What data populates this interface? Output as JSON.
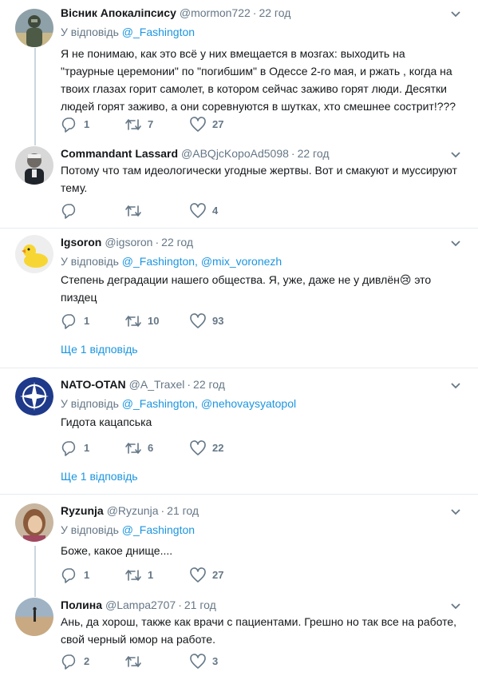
{
  "tweets": [
    {
      "name": "Вісник Апокаліпсису",
      "handle": "@mormon722",
      "time": "22 год",
      "reply_prefix": "У відповідь",
      "reply_to": [
        "@_Fashington"
      ],
      "text": "Я не понимаю, как это всё у них вмещается в мозгах: выходить на \"траурные церемонии\" по \"погибшим\" в Одессе 2-го мая, и ржать , когда на твоих глазах горит самолет, в котором сейчас заживо горят люди. Десятки людей горят заживо, а они соревнуются в шутках, хто смешнее сострит!???",
      "replies": "1",
      "retweets": "7",
      "likes": "27"
    },
    {
      "name": "Commandant Lassard",
      "handle": "@ABQjcKopoAd5098",
      "time": "22 год",
      "text": "Потому что там идеологически угодные жертвы. Вот и смакуют  и муссируют тему.",
      "replies": "",
      "retweets": "",
      "likes": "4"
    },
    {
      "name": "Igsoron",
      "handle": "@igsoron",
      "time": "22 год",
      "reply_prefix": "У відповідь",
      "reply_to": [
        "@_Fashington,",
        "@mix_voronezh"
      ],
      "text": "Степень деградации нашего общества. Я, уже, даже не у дивлён😢 это пиздец",
      "replies": "1",
      "retweets": "10",
      "likes": "93",
      "more": "Ще 1 відповідь"
    },
    {
      "name": "NATO-OTAN",
      "handle": "@A_Traxel",
      "time": "22 год",
      "reply_prefix": "У відповідь",
      "reply_to": [
        "@_Fashington,",
        "@nehovaysyatopol"
      ],
      "text": "Гидота кацапська",
      "replies": "1",
      "retweets": "6",
      "likes": "22",
      "more": "Ще 1 відповідь"
    },
    {
      "name": "Ryzunja",
      "handle": "@Ryzunja",
      "time": "21 год",
      "reply_prefix": "У відповідь",
      "reply_to": [
        "@_Fashington"
      ],
      "text": "Боже, какое днище....",
      "replies": "1",
      "retweets": "1",
      "likes": "27"
    },
    {
      "name": "Полина",
      "handle": "@Lampa2707",
      "time": "21 год",
      "text": "Ань, да хорош, также как врачи с пациентами. Грешно но так все на работе, свой черный юмор на работе.",
      "replies": "2",
      "retweets": "",
      "likes": "3"
    }
  ],
  "colors": {
    "link": "#1b95e0",
    "muted": "#657786",
    "separator": "#e6ecf0",
    "thread_line": "#ccd6dd"
  },
  "icons": [
    "reply-icon",
    "retweet-icon",
    "like-icon",
    "caret-down-icon"
  ]
}
